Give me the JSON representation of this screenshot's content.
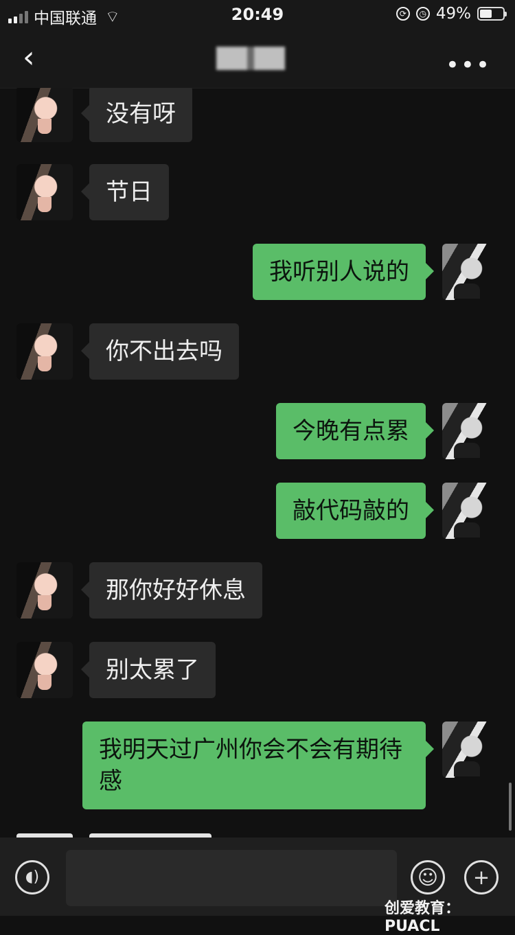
{
  "status": {
    "carrier": "中国联通",
    "time": "20:49",
    "battery": "49%"
  },
  "watermark": "创爱教育：PUACL",
  "messages": [
    {
      "side": "left",
      "text": "没有呀"
    },
    {
      "side": "left",
      "text": "节日"
    },
    {
      "side": "right",
      "text": "我听别人说的"
    },
    {
      "side": "left",
      "text": "你不出去吗"
    },
    {
      "side": "right",
      "text": "今晚有点累"
    },
    {
      "side": "right",
      "text": "敲代码敲的"
    },
    {
      "side": "left",
      "text": "那你好好休息"
    },
    {
      "side": "left",
      "text": "别太累了"
    },
    {
      "side": "right",
      "text": "我明天过广州你会不会有期待感"
    }
  ]
}
